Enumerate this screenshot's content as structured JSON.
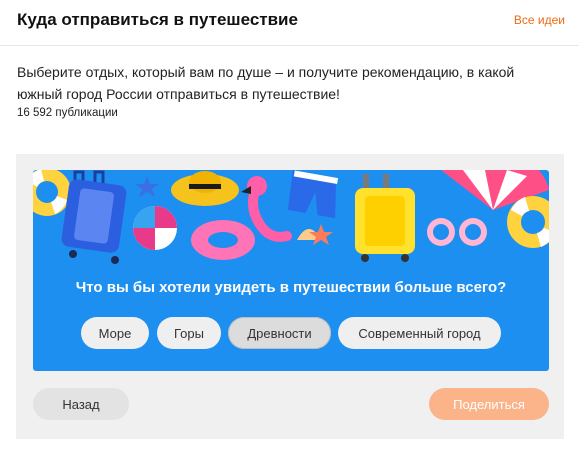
{
  "header": {
    "title": "Куда отправиться в путешествие",
    "all_ideas": "Все идеи"
  },
  "description": "Выберите отдых, который вам по душе – и получите рекомендацию, в какой южный город России отправиться в путешествие!",
  "publications": "16 592 публикации",
  "quiz": {
    "question": "Что вы бы хотели увидеть в путешествии больше всего?",
    "options": [
      "Море",
      "Горы",
      "Древности",
      "Современный город"
    ],
    "selected_option": "Древности"
  },
  "footer": {
    "back_label": "Назад",
    "share_label": "Поделиться"
  },
  "colors": {
    "accent": "#ee6a14",
    "card_bg": "#1d8ff0",
    "share_disabled": "#fbb48a"
  }
}
